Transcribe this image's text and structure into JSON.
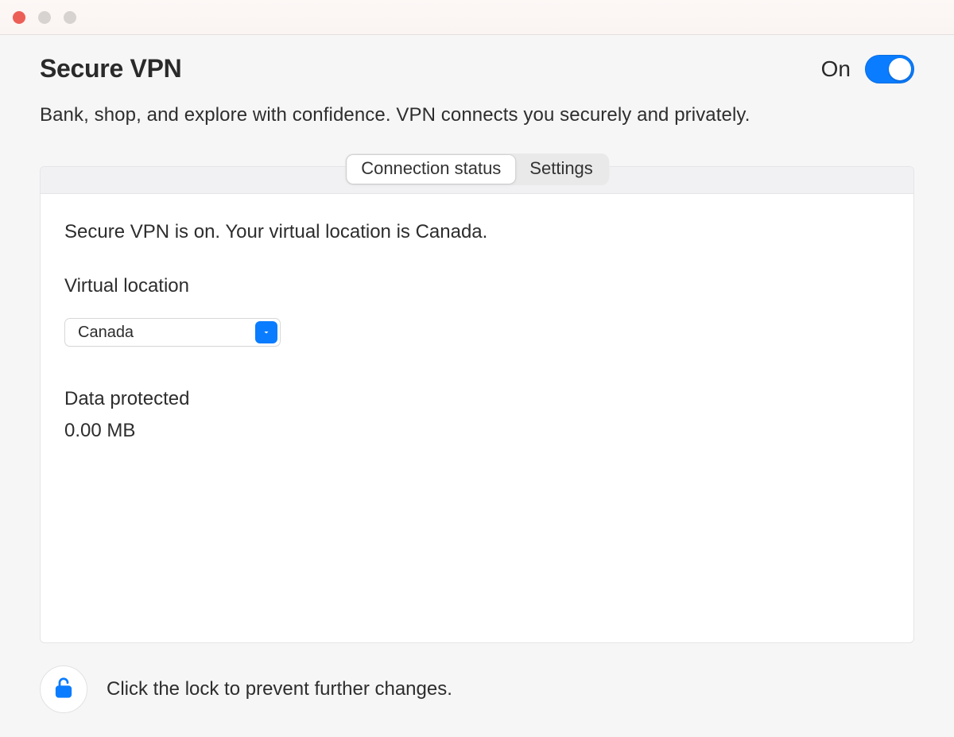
{
  "header": {
    "title": "Secure VPN",
    "toggle_state_label": "On",
    "toggle_on": true,
    "subtitle": "Bank, shop, and explore with confidence. VPN connects you securely and privately."
  },
  "tabs": {
    "connection_status": "Connection status",
    "settings": "Settings",
    "active": "connection_status"
  },
  "status": {
    "message": "Secure VPN is on. Your virtual location is Canada.",
    "virtual_location_label": "Virtual location",
    "virtual_location_value": "Canada",
    "data_protected_label": "Data protected",
    "data_protected_value": "0.00 MB"
  },
  "footer": {
    "lock_text": "Click the lock to prevent further changes."
  },
  "colors": {
    "accent": "#0a7cff"
  }
}
